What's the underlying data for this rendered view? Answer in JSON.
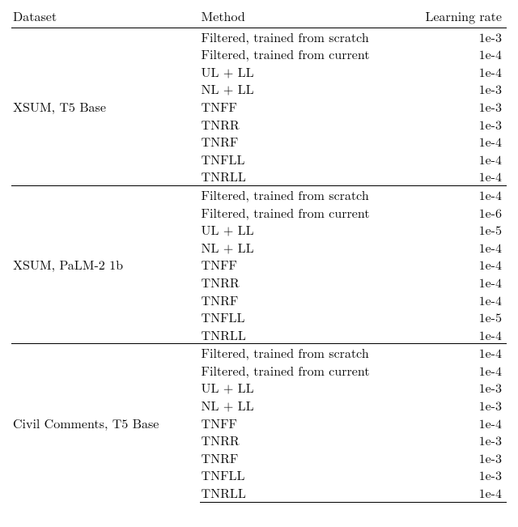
{
  "chart_data": {
    "type": "table",
    "columns": [
      "Dataset",
      "Method",
      "Learning rate"
    ],
    "groups": [
      {
        "dataset": "XSUM, T5 Base",
        "rows": [
          {
            "method": "Filtered, trained from scratch",
            "lr": "1e-3"
          },
          {
            "method": "Filtered, trained from current",
            "lr": "1e-4"
          },
          {
            "method": "UL + LL",
            "lr": "1e-4"
          },
          {
            "method": "NL + LL",
            "lr": "1e-3"
          },
          {
            "method": "TNFF",
            "lr": "1e-3"
          },
          {
            "method": "TNRR",
            "lr": "1e-3"
          },
          {
            "method": "TNRF",
            "lr": "1e-4"
          },
          {
            "method": "TNFLL",
            "lr": "1e-4"
          },
          {
            "method": "TNRLL",
            "lr": "1e-4"
          }
        ]
      },
      {
        "dataset": "XSUM, PaLM-2 1b",
        "rows": [
          {
            "method": "Filtered, trained from scratch",
            "lr": "1e-4"
          },
          {
            "method": "Filtered, trained from current",
            "lr": "1e-6"
          },
          {
            "method": "UL + LL",
            "lr": "1e-5"
          },
          {
            "method": "NL + LL",
            "lr": "1e-4"
          },
          {
            "method": "TNFF",
            "lr": "1e-4"
          },
          {
            "method": "TNRR",
            "lr": "1e-4"
          },
          {
            "method": "TNRF",
            "lr": "1e-4"
          },
          {
            "method": "TNFLL",
            "lr": "1e-5"
          },
          {
            "method": "TNRLL",
            "lr": "1e-4"
          }
        ]
      },
      {
        "dataset": "Civil Comments, T5 Base",
        "rows": [
          {
            "method": "Filtered, trained from scratch",
            "lr": "1e-4"
          },
          {
            "method": "Filtered, trained from current",
            "lr": "1e-4"
          },
          {
            "method": "UL + LL",
            "lr": "1e-3"
          },
          {
            "method": "NL + LL",
            "lr": "1e-3"
          },
          {
            "method": "TNFF",
            "lr": "1e-4"
          },
          {
            "method": "TNRR",
            "lr": "1e-3"
          },
          {
            "method": "TNRF",
            "lr": "1e-3"
          },
          {
            "method": "TNFLL",
            "lr": "1e-3"
          },
          {
            "method": "TNRLL",
            "lr": "1e-4"
          }
        ]
      }
    ]
  }
}
